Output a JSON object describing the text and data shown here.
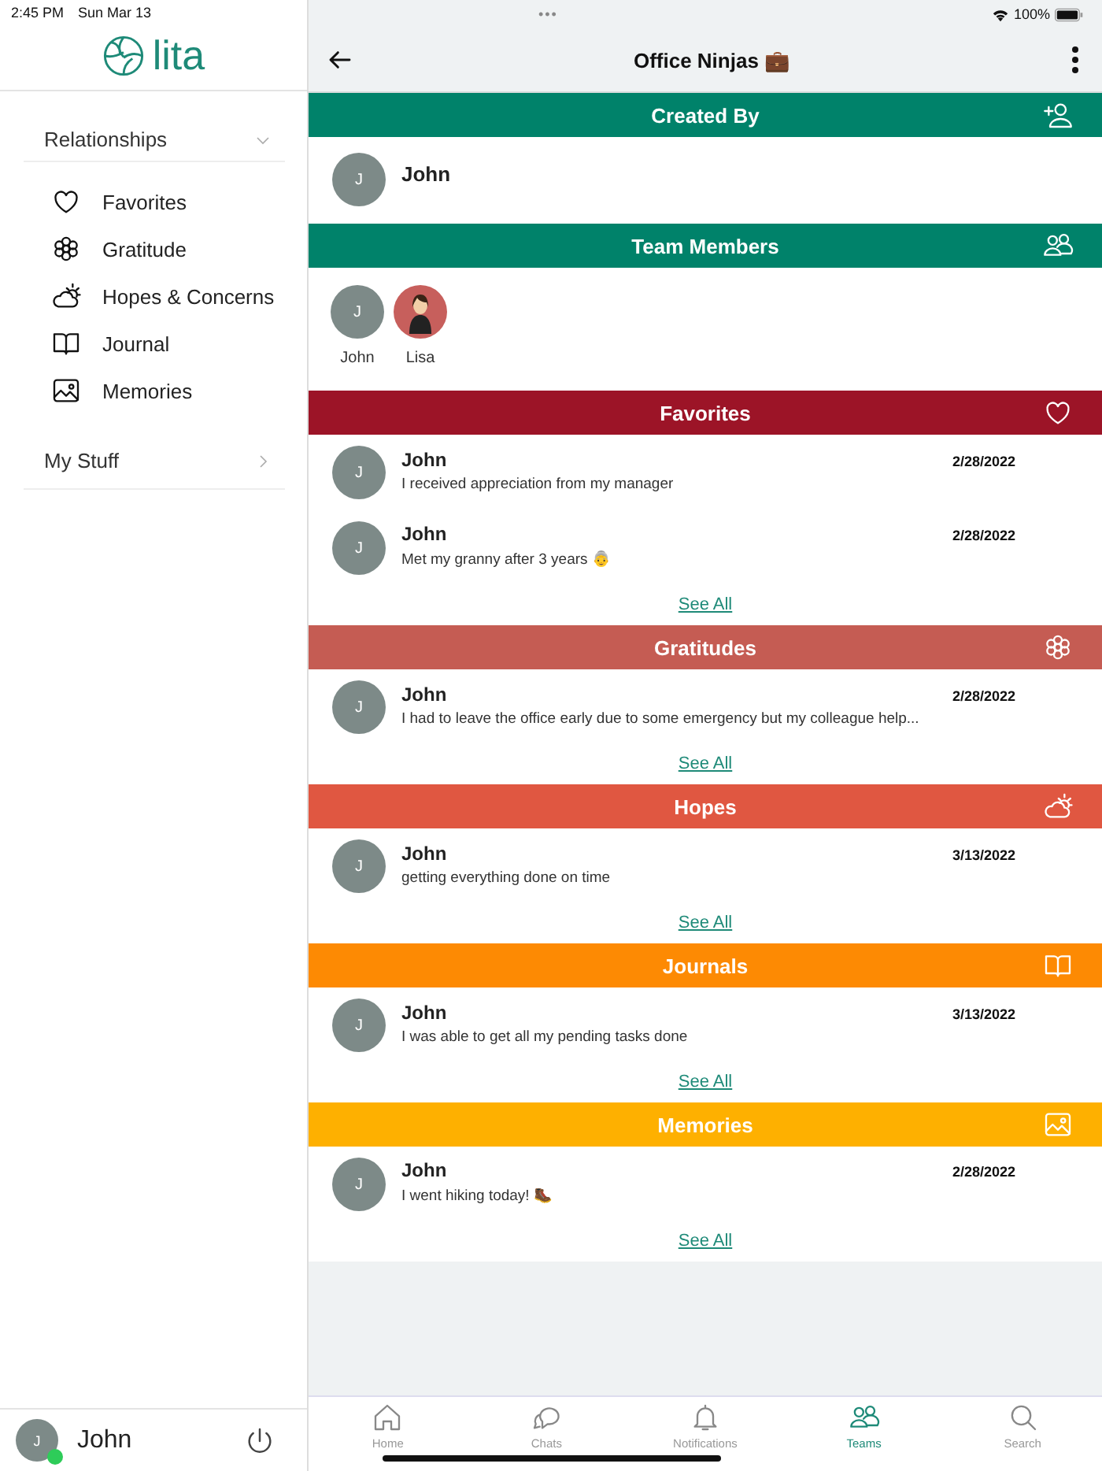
{
  "status_bar": {
    "time": "2:45 PM",
    "date": "Sun Mar 13",
    "dots": "•••",
    "battery": "100%"
  },
  "sidebar": {
    "logo": "lita",
    "groups": [
      {
        "label": "Relationships",
        "expanded": true,
        "items": [
          {
            "kind": "heart",
            "label": "Favorites"
          },
          {
            "kind": "flower",
            "label": "Gratitude"
          },
          {
            "kind": "cloud",
            "label": "Hopes & Concerns"
          },
          {
            "kind": "book",
            "label": "Journal"
          },
          {
            "kind": "image",
            "label": "Memories"
          }
        ]
      },
      {
        "label": "My Stuff",
        "expanded": false
      }
    ],
    "user": {
      "initial": "J",
      "name": "John",
      "online": true
    }
  },
  "header": {
    "title": "Office Ninjas 💼"
  },
  "sections": [
    {
      "kind": "creator",
      "title": "Created By",
      "color": "#00826a",
      "people": [
        {
          "initial": "J",
          "name": "John"
        }
      ]
    },
    {
      "kind": "members",
      "title": "Team Members",
      "color": "#00826a",
      "people": [
        {
          "initial": "J",
          "name": "John",
          "photo": false
        },
        {
          "name": "Lisa",
          "photo": true
        }
      ]
    },
    {
      "kind": "favorites",
      "title": "Favorites",
      "color": "#9c1427",
      "link": "See All",
      "entries": [
        {
          "initial": "J",
          "name": "John",
          "date": "2/28/2022",
          "text": "I received appreciation from my manager"
        },
        {
          "initial": "J",
          "name": "John",
          "date": "2/28/2022",
          "text": "Met my granny after 3 years 👵"
        }
      ]
    },
    {
      "kind": "gratitudes",
      "title": "Gratitudes",
      "color": "#c55c53",
      "link": "See All",
      "entries": [
        {
          "initial": "J",
          "name": "John",
          "date": "2/28/2022",
          "text": "I had to leave the office early due to some emergency but my colleague help..."
        }
      ]
    },
    {
      "kind": "hopes",
      "title": "Hopes",
      "color": "#e05741",
      "link": "See All",
      "entries": [
        {
          "initial": "J",
          "name": "John",
          "date": "3/13/2022",
          "text": "getting everything done on time"
        }
      ]
    },
    {
      "kind": "journals",
      "title": "Journals",
      "color": "#fd8a03",
      "link": "See All",
      "entries": [
        {
          "initial": "J",
          "name": "John",
          "date": "3/13/2022",
          "text": "I was able to get all my pending tasks done"
        }
      ]
    },
    {
      "kind": "memories",
      "title": "Memories",
      "color": "#feb000",
      "link": "See All",
      "entries": [
        {
          "initial": "J",
          "name": "John",
          "date": "2/28/2022",
          "text": "I went hiking today! 🥾"
        }
      ]
    }
  ],
  "tab_bar": [
    {
      "kind": "home",
      "label": "Home",
      "selected": false
    },
    {
      "kind": "chat",
      "label": "Chats",
      "selected": false
    },
    {
      "kind": "bell",
      "label": "Notifications",
      "selected": false
    },
    {
      "kind": "people",
      "label": "Teams",
      "selected": true
    },
    {
      "kind": "search",
      "label": "Search",
      "selected": false
    }
  ]
}
